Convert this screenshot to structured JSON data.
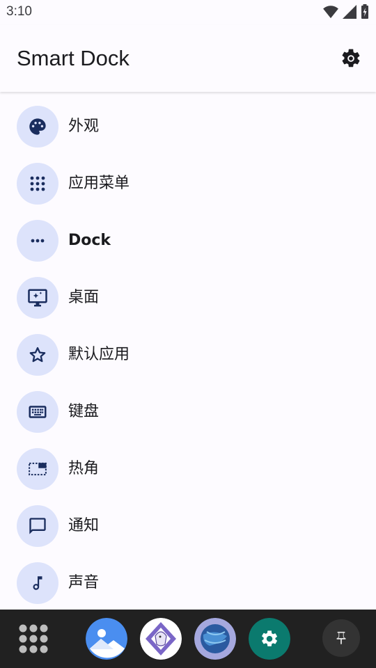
{
  "status_bar": {
    "time": "3:10",
    "icons": [
      "wifi-icon",
      "signal-icon",
      "battery-charging-icon"
    ]
  },
  "app_bar": {
    "title": "Smart Dock",
    "action_icon": "gear-icon"
  },
  "menu": {
    "items": [
      {
        "label": "外观",
        "icon": "palette-icon"
      },
      {
        "label": "应用菜单",
        "icon": "apps-grid-icon"
      },
      {
        "label": "Dock",
        "icon": "more-horiz-icon"
      },
      {
        "label": "桌面",
        "icon": "desktop-icon"
      },
      {
        "label": "默认应用",
        "icon": "star-icon"
      },
      {
        "label": "键盘",
        "icon": "keyboard-icon"
      },
      {
        "label": "热角",
        "icon": "hot-corner-icon"
      },
      {
        "label": "通知",
        "icon": "message-icon"
      },
      {
        "label": "声音",
        "icon": "music-note-icon"
      }
    ]
  },
  "dock": {
    "launcher_icon": "apps-grid-icon",
    "apps": [
      "gallery-app-icon",
      "pdf-app-icon",
      "browser-app-icon",
      "settings-app-icon"
    ],
    "pin_icon": "pin-icon"
  },
  "colors": {
    "background": "#fdfbff",
    "icon_bg": "#dde3fb",
    "icon_fg": "#1a2d5e",
    "dock_bg": "#212121"
  }
}
